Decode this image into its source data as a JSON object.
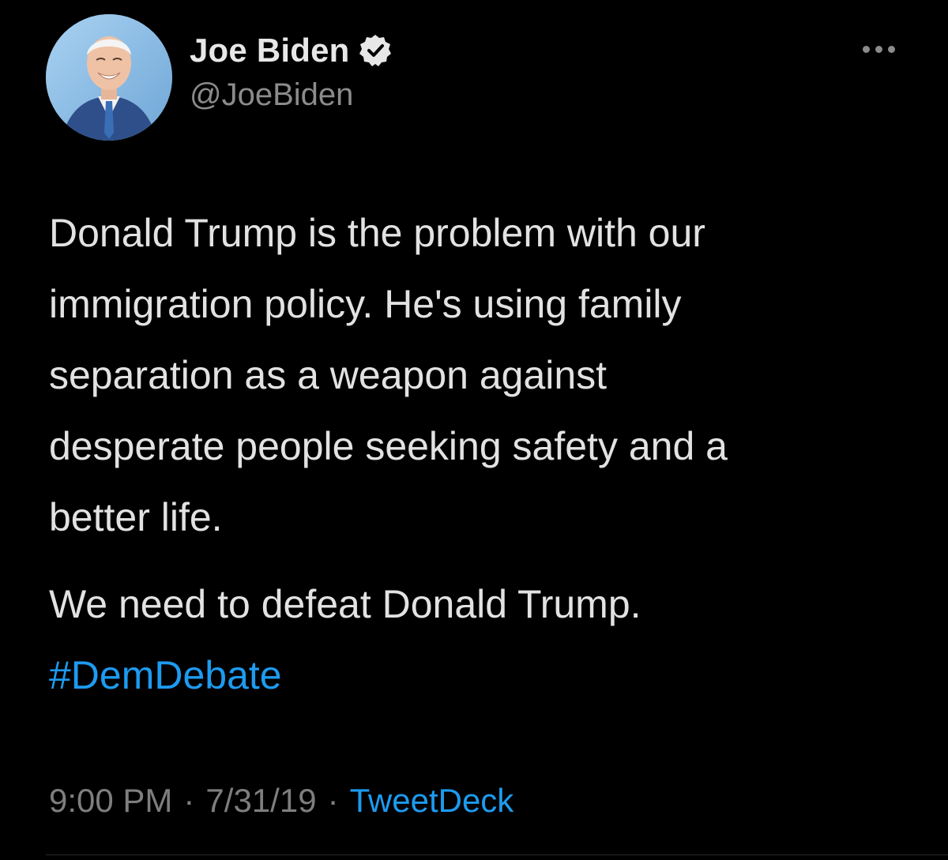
{
  "author": {
    "display_name": "Joe Biden",
    "handle": "@JoeBiden",
    "verified_icon": "verified-badge-icon",
    "avatar_icon": "profile-photo"
  },
  "tweet": {
    "paragraph_1": "Donald Trump is the problem with our\nimmigration policy. He's using family\nseparation as a weapon against\ndesperate people seeking safety and a\nbetter life.",
    "paragraph_2": "We need to defeat Donald Trump.",
    "hashtag": "#DemDebate"
  },
  "meta": {
    "time": "9:00 PM",
    "separator_1": "·",
    "date": "7/31/19",
    "separator_2": "·",
    "source": "TweetDeck"
  },
  "colors": {
    "background": "#000000",
    "link": "#1d9bf0",
    "secondary_text": "#8b8b8b"
  }
}
